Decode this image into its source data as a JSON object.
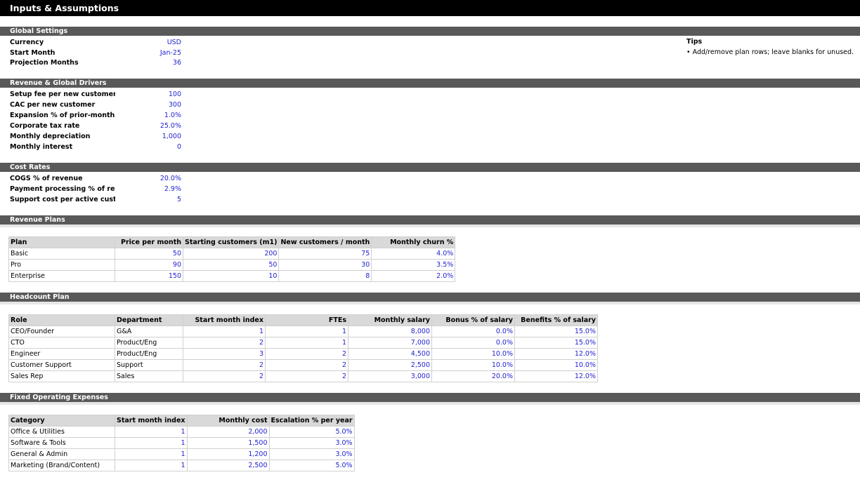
{
  "title": "Inputs & Assumptions",
  "global_settings": {
    "header": "Global Settings",
    "rows": [
      {
        "label": "Currency",
        "value": "USD"
      },
      {
        "label": "Start Month",
        "value": "Jan-25"
      },
      {
        "label": "Projection Months",
        "value": "36"
      }
    ]
  },
  "tips": {
    "title": "Tips",
    "item": "• Add/remove plan rows; leave blanks for unused."
  },
  "revenue_drivers": {
    "header": "Revenue & Global Drivers",
    "rows": [
      {
        "label": "Setup fee per new customer",
        "value": "100"
      },
      {
        "label": "CAC per new customer",
        "value": "300"
      },
      {
        "label": "Expansion % of prior-month MRR",
        "value": "1.0%"
      },
      {
        "label": "Corporate tax rate",
        "value": "25.0%"
      },
      {
        "label": "Monthly depreciation",
        "value": "1,000"
      },
      {
        "label": "Monthly interest",
        "value": "0"
      }
    ]
  },
  "cost_rates": {
    "header": "Cost Rates",
    "rows": [
      {
        "label": "COGS % of revenue",
        "value": "20.0%"
      },
      {
        "label": "Payment processing % of revenue",
        "value": "2.9%"
      },
      {
        "label": "Support cost per active customer",
        "value": "5"
      }
    ]
  },
  "revenue_plans": {
    "header": "Revenue Plans",
    "columns": [
      "Plan",
      "Price per month",
      "Starting customers (m1)",
      "New customers / month",
      "Monthly churn %"
    ],
    "rows": [
      [
        "Basic",
        "50",
        "200",
        "75",
        "4.0%"
      ],
      [
        "Pro",
        "90",
        "50",
        "30",
        "3.5%"
      ],
      [
        "Enterprise",
        "150",
        "10",
        "8",
        "2.0%"
      ]
    ]
  },
  "headcount_plan": {
    "header": "Headcount Plan",
    "columns": [
      "Role",
      "Department",
      "Start month index",
      "FTEs",
      "Monthly salary",
      "Bonus % of salary",
      "Benefits % of salary"
    ],
    "rows": [
      [
        "CEO/Founder",
        "G&A",
        "1",
        "1",
        "8,000",
        "0.0%",
        "15.0%"
      ],
      [
        "CTO",
        "Product/Eng",
        "2",
        "1",
        "7,000",
        "0.0%",
        "15.0%"
      ],
      [
        "Engineer",
        "Product/Eng",
        "3",
        "2",
        "4,500",
        "10.0%",
        "12.0%"
      ],
      [
        "Customer Support",
        "Support",
        "2",
        "2",
        "2,500",
        "10.0%",
        "10.0%"
      ],
      [
        "Sales Rep",
        "Sales",
        "2",
        "2",
        "3,000",
        "20.0%",
        "12.0%"
      ]
    ]
  },
  "fixed_opex": {
    "header": "Fixed Operating Expenses",
    "columns": [
      "Category",
      "Start month index",
      "Monthly cost",
      "Escalation % per year"
    ],
    "rows": [
      [
        "Office & Utilities",
        "1",
        "2,000",
        "5.0%"
      ],
      [
        "Software & Tools",
        "1",
        "1,500",
        "3.0%"
      ],
      [
        "General & Admin",
        "1",
        "1,200",
        "3.0%"
      ],
      [
        "Marketing (Brand/Content)",
        "1",
        "2,500",
        "5.0%"
      ]
    ]
  },
  "colors": {
    "input_blue": "#1f1fd1",
    "section_bar": "#595959",
    "title_bar": "#000000",
    "header_fill": "#d9d9d9"
  }
}
